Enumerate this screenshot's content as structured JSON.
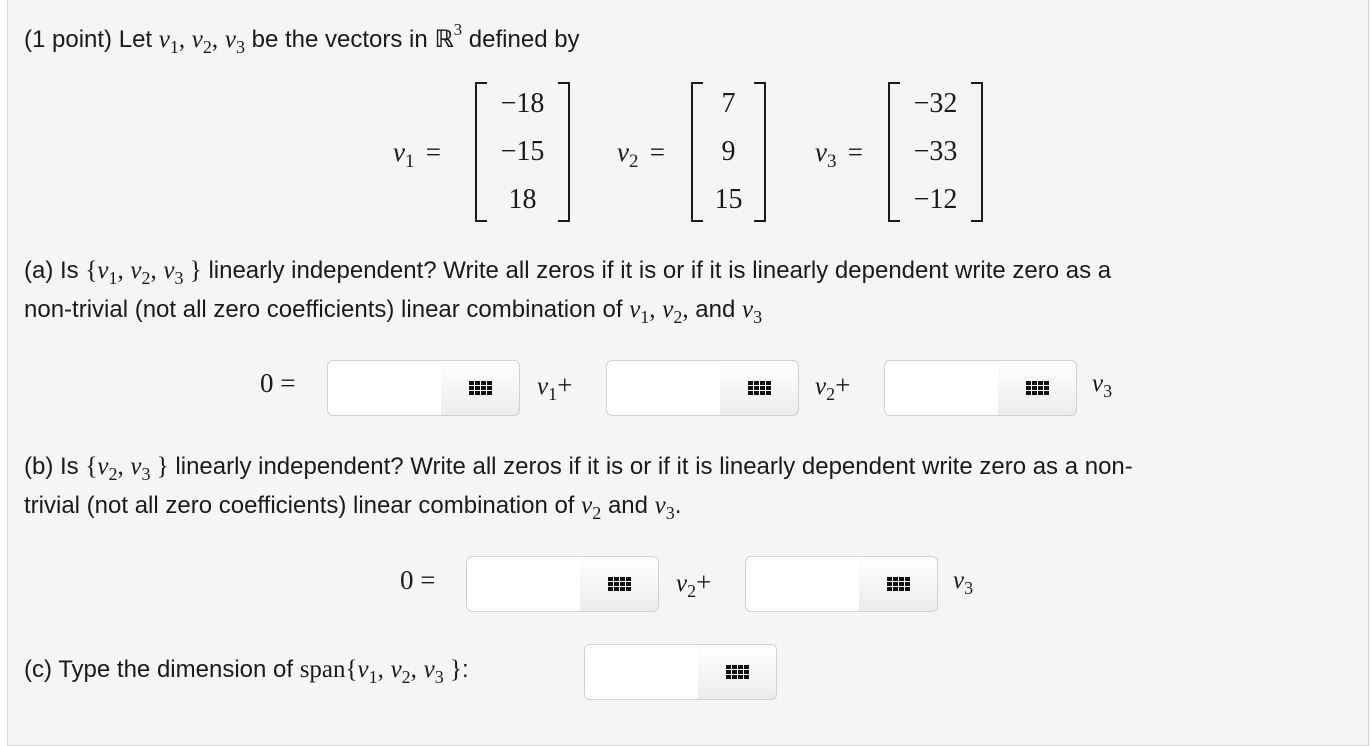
{
  "intro": {
    "points": "(1 point)",
    "let_text": "Let",
    "v1": "v",
    "v1_sub": "1",
    "v2": "v",
    "v2_sub": "2",
    "v3": "v",
    "v3_sub": "3",
    "be_text": "be the vectors in",
    "space": "ℝ",
    "space_exp": "3",
    "defined_text": "defined by"
  },
  "vectors": [
    {
      "name": "v",
      "sub": "1",
      "values": [
        "−18",
        "−15",
        "18"
      ]
    },
    {
      "name": "v",
      "sub": "2",
      "values": [
        "7",
        "9",
        "15"
      ]
    },
    {
      "name": "v",
      "sub": "3",
      "values": [
        "−32",
        "−33",
        "−12"
      ]
    }
  ],
  "part_a": {
    "label": "(a) Is",
    "line1_rest": "linearly independent? Write all zeros if it is or if it is linearly dependent write zero as a",
    "line2": "non-trivial (not all zero coefficients) linear combination of",
    "and_text": "and",
    "eq_lhs": "0 =",
    "plus": "+"
  },
  "part_b": {
    "label": "(b) Is",
    "line1_rest": "linearly independent? Write all zeros if it is or if it is linearly dependent write zero as a non-",
    "line2": "trivial (not all zero coefficients) linear combination of",
    "and_text": "and",
    "period": ".",
    "eq_lhs": "0 =",
    "plus": "+"
  },
  "part_c": {
    "label": "(c) Type the dimension of",
    "span": "span",
    "colon": ":"
  },
  "inputs": {
    "a1": "",
    "a2": "",
    "a3": "",
    "b2": "",
    "b3": "",
    "c": ""
  }
}
